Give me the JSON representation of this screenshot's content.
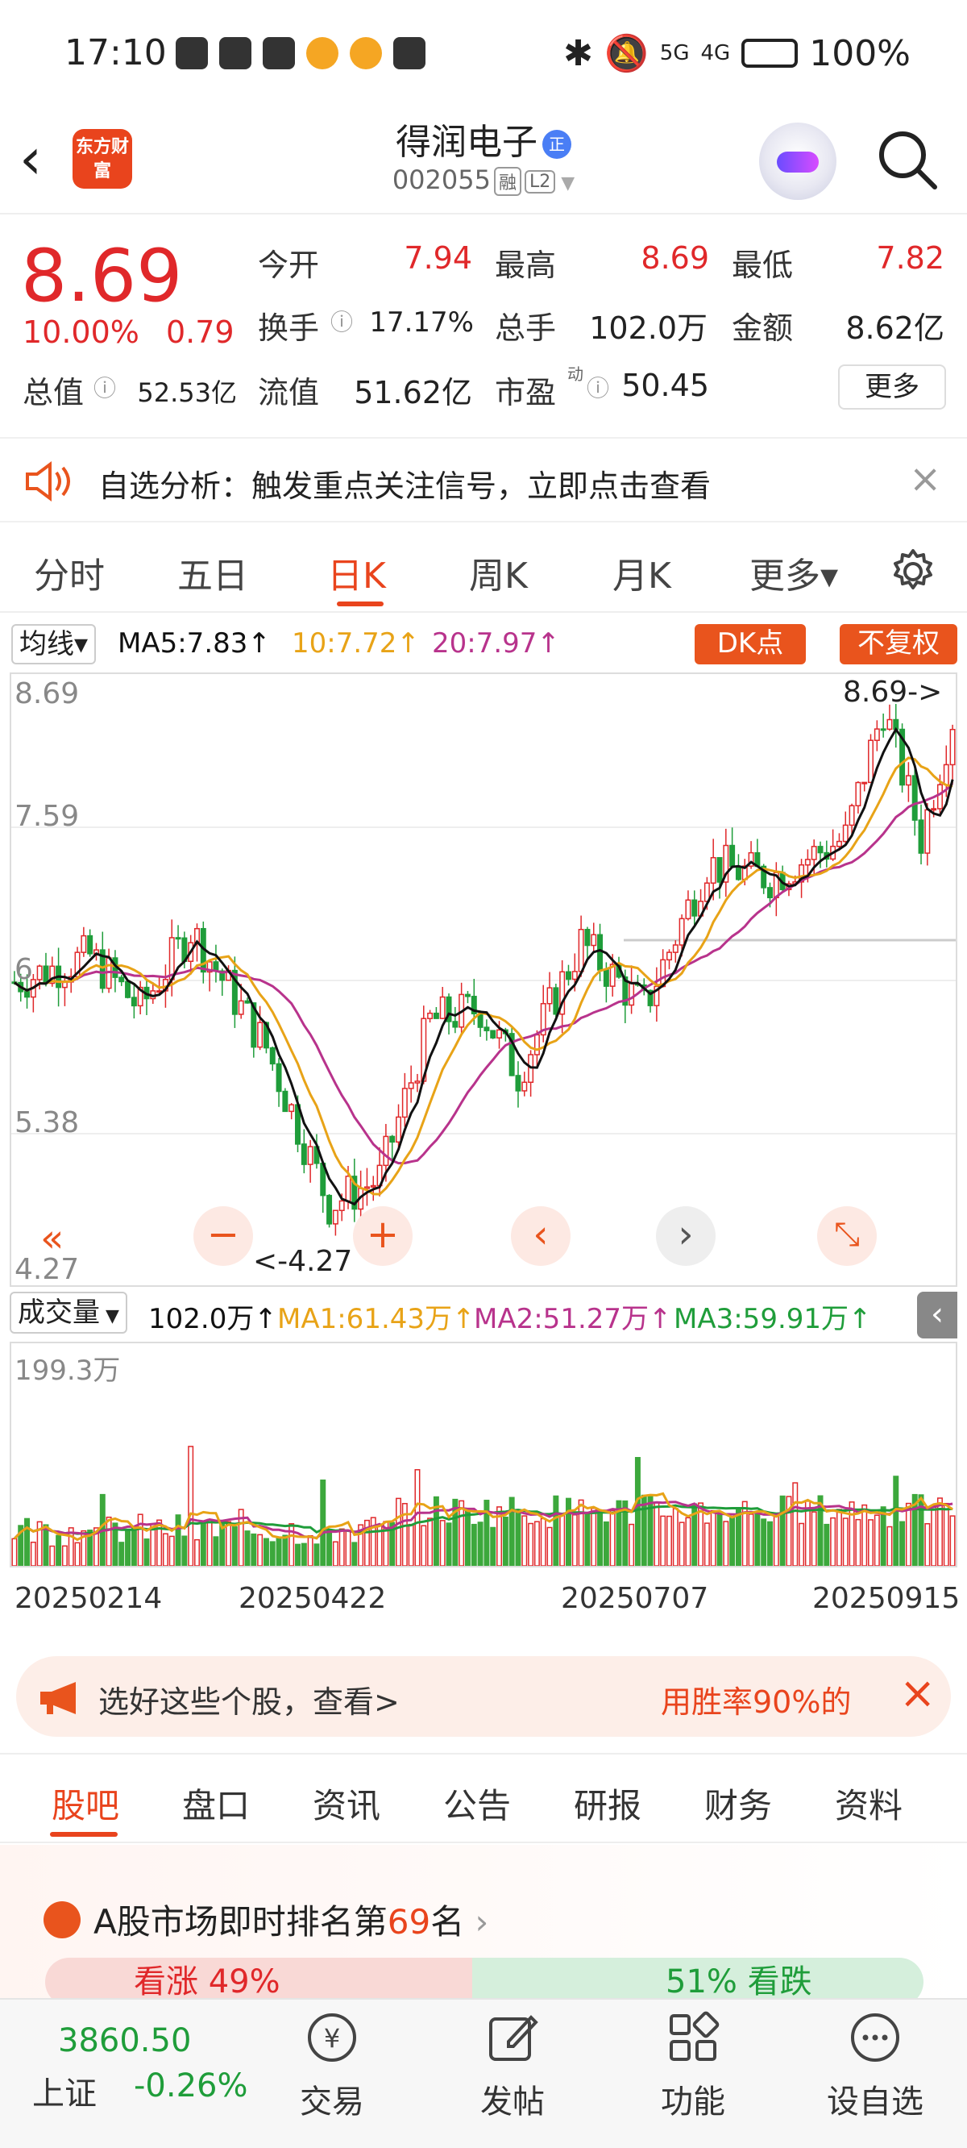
{
  "status_bar": {
    "time": "17:10",
    "battery": "100%",
    "network_5g": "5G",
    "network_4g": "4G"
  },
  "header": {
    "logo_text": "东方财富",
    "stock_name": "得润电子",
    "name_badge": "正",
    "stock_code": "002055",
    "tag_margin": "融",
    "tag_level": "L2"
  },
  "quote": {
    "price": "8.69",
    "change_pct": "10.00%",
    "change": "0.79",
    "open_label": "今开",
    "open": "7.94",
    "high_label": "最高",
    "high": "8.69",
    "low_label": "最低",
    "low": "7.82",
    "turnover_label": "换手",
    "turnover": "17.17%",
    "volume_label": "总手",
    "volume": "102.0万",
    "amount_label": "金额",
    "amount": "8.62亿",
    "mktcap_label": "总值",
    "mktcap": "52.53亿",
    "float_label": "流值",
    "float": "51.62亿",
    "pe_label": "市盈",
    "pe_sup": "动",
    "pe": "50.45",
    "more": "更多"
  },
  "notice": {
    "text": "自选分析：触发重点关注信号，立即点击查看"
  },
  "chart_tabs": [
    "分时",
    "五日",
    "日K",
    "周K",
    "月K",
    "更多▾"
  ],
  "ma_bar": {
    "select": "均线▾",
    "ma5": "MA5:7.83↑",
    "ma10": "10:7.72↑",
    "ma20": "20:7.97↑",
    "dk": "DK点",
    "fq": "不复权"
  },
  "kline_labels": {
    "p1": "8.69",
    "p2": "7.59",
    "p3": "6",
    "p4": "5.38",
    "p5": "4.27",
    "max_note": "8.69->",
    "min_note": "<-4.27"
  },
  "volume_bar": {
    "select": "成交量",
    "total": "102.0万↑",
    "ma1": "MA1:61.43万↑",
    "ma2": "MA2:51.27万↑",
    "ma3": "MA3:59.91万↑",
    "max": "199.3万"
  },
  "dates": [
    "20250214",
    "20250422",
    "20250707",
    "20250915"
  ],
  "ad": {
    "left": "选好这些个股，查看>",
    "right": "用胜率90%的"
  },
  "bottom_tabs": [
    "股吧",
    "盘口",
    "资讯",
    "公告",
    "研报",
    "财务",
    "资料"
  ],
  "rank": {
    "prefix": "A股市场即时排名第",
    "num": "69",
    "suffix": "名"
  },
  "sentiment": {
    "up": "看涨 49%",
    "down": "51% 看跌"
  },
  "index": {
    "value": "3860.50",
    "name": "上证",
    "change": "-0.26%"
  },
  "nav": [
    "交易",
    "发帖",
    "功能",
    "设自选"
  ],
  "colors": {
    "up": "#e0282a",
    "down": "#1f9d3a",
    "accent": "#e9441d",
    "ma5": "#111111",
    "ma10": "#e8a317",
    "ma20": "#b8338c"
  }
}
